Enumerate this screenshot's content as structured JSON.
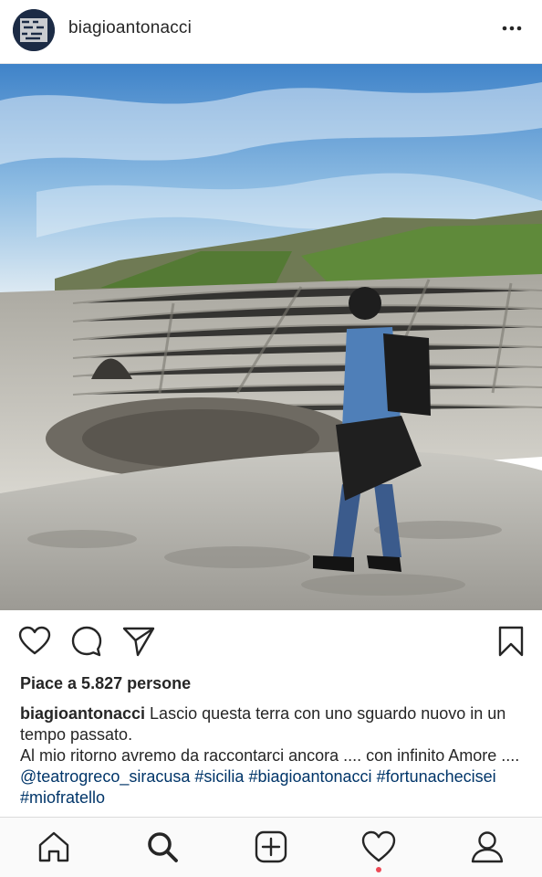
{
  "post": {
    "username": "biagioantonacci",
    "likes_text": "Piace a 5.827 persone",
    "caption_user": "biagioantonacci",
    "caption_line1": "Lascio questa terra con uno sguardo nuovo in un tempo passato.",
    "caption_line2": "Al mio ritorno avremo da raccontarci ancora .... con infinito Amore ....",
    "mention": "@teatrogreco_siracusa",
    "hashtags": [
      "#sicilia",
      "#biagioantonacci",
      "#fortunachecisei",
      "#miofratello"
    ]
  },
  "icons": {
    "header": [
      "avatar",
      "more-icon"
    ],
    "actions": [
      "heart-icon",
      "comment-icon",
      "share-icon",
      "bookmark-icon"
    ],
    "tabbar": [
      "home-icon",
      "search-icon",
      "add-icon",
      "activity-icon",
      "profile-icon"
    ]
  },
  "colors": {
    "link": "#003569",
    "notification_dot": "#ed4956",
    "text": "#262626"
  }
}
